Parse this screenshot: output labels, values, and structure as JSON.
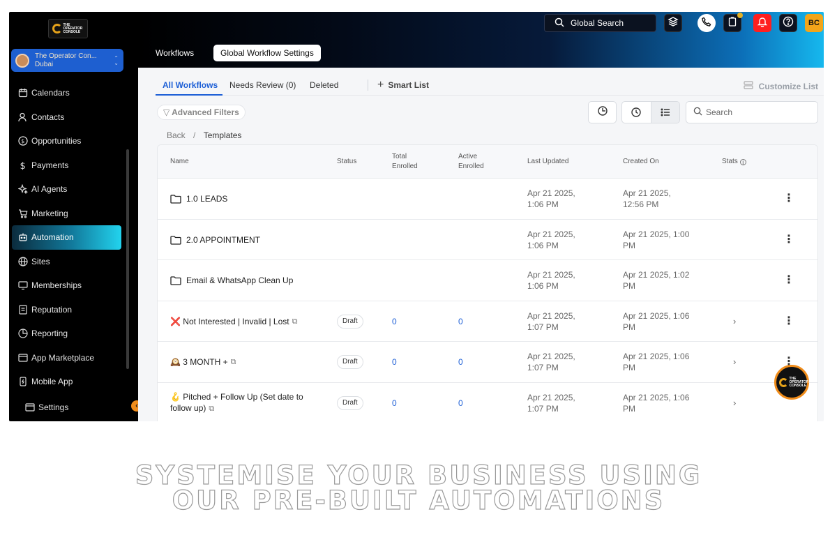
{
  "brand": {
    "logo_text": "THE OPERATOR CONSOLE"
  },
  "account": {
    "name": "The Operator Con...",
    "location": "Dubai"
  },
  "sidebar": {
    "items": [
      {
        "label": "Calendars",
        "icon": "calendar-icon"
      },
      {
        "label": "Contacts",
        "icon": "contacts-icon"
      },
      {
        "label": "Opportunities",
        "icon": "dollar-circle-icon"
      },
      {
        "label": "Payments",
        "icon": "dollar-icon"
      },
      {
        "label": "AI Agents",
        "icon": "sparkle-icon"
      },
      {
        "label": "Marketing",
        "icon": "cart-icon"
      },
      {
        "label": "Automation",
        "icon": "robot-icon",
        "active": true
      },
      {
        "label": "Sites",
        "icon": "globe-icon"
      },
      {
        "label": "Memberships",
        "icon": "membership-icon"
      },
      {
        "label": "Reputation",
        "icon": "reputation-icon"
      },
      {
        "label": "Reporting",
        "icon": "reporting-icon"
      },
      {
        "label": "App Marketplace",
        "icon": "marketplace-icon"
      },
      {
        "label": "Mobile App",
        "icon": "mobile-icon"
      }
    ],
    "settings_label": "Settings"
  },
  "topbar": {
    "tabs": [
      "Workflows",
      "Global Workflow Settings"
    ],
    "global_search": "Global Search",
    "user_initials": "BC"
  },
  "subtabs": {
    "all": "All Workflows",
    "needs_review": "Needs Review (0)",
    "deleted": "Deleted",
    "smart_list": "Smart List",
    "customize": "Customize List"
  },
  "filters": {
    "advanced": "Advanced Filters",
    "search_placeholder": "Search"
  },
  "breadcrumb": {
    "back": "Back",
    "separator": "/",
    "current": "Templates"
  },
  "table": {
    "headers": {
      "name": "Name",
      "status": "Status",
      "total": [
        "Total",
        "Enrolled"
      ],
      "active": [
        "Active",
        "Enrolled"
      ],
      "updated": "Last Updated",
      "created": "Created On",
      "stats": "Stats"
    },
    "rows": [
      {
        "name": "1.0 LEADS",
        "type": "folder",
        "updated": [
          "Apr 21 2025,",
          "1:06 PM"
        ],
        "created": [
          "Apr 21 2025,",
          "12:56 PM"
        ]
      },
      {
        "name": "2.0 APPOINTMENT",
        "type": "folder",
        "updated": [
          "Apr 21 2025,",
          "1:06 PM"
        ],
        "created": [
          "Apr 21 2025, 1:00",
          "PM"
        ]
      },
      {
        "name": "Email & WhatsApp Clean Up",
        "type": "folder",
        "updated": [
          "Apr 21 2025,",
          "1:06 PM"
        ],
        "created": [
          "Apr 21 2025, 1:02",
          "PM"
        ]
      },
      {
        "name": "❌ Not Interested | Invalid | Lost",
        "type": "workflow",
        "status": "Draft",
        "total": "0",
        "active": "0",
        "updated": [
          "Apr 21 2025,",
          "1:07 PM"
        ],
        "created": [
          "Apr 21 2025, 1:06",
          "PM"
        ]
      },
      {
        "name": "🕰️ 3 MONTH +",
        "type": "workflow",
        "status": "Draft",
        "total": "0",
        "active": "0",
        "updated": [
          "Apr 21 2025,",
          "1:07 PM"
        ],
        "created": [
          "Apr 21 2025, 1:06",
          "PM"
        ]
      },
      {
        "name": "🪝 Pitched + Follow Up (Set date to",
        "name2": "follow up)",
        "type": "workflow",
        "status": "Draft",
        "total": "0",
        "active": "0",
        "updated": [
          "Apr 21 2025,",
          "1:07 PM"
        ],
        "created": [
          "Apr 21 2025, 1:06",
          "PM"
        ]
      }
    ]
  },
  "headline": [
    "SYSTEMISE YOUR BUSINESS USING",
    "OUR PRE-BUILT AUTOMATIONS"
  ],
  "colors": {
    "accent": "#1d5fd6",
    "active_nav": "#22d3ee",
    "orange": "#f08c1a",
    "alert": "#ff1f1f"
  }
}
